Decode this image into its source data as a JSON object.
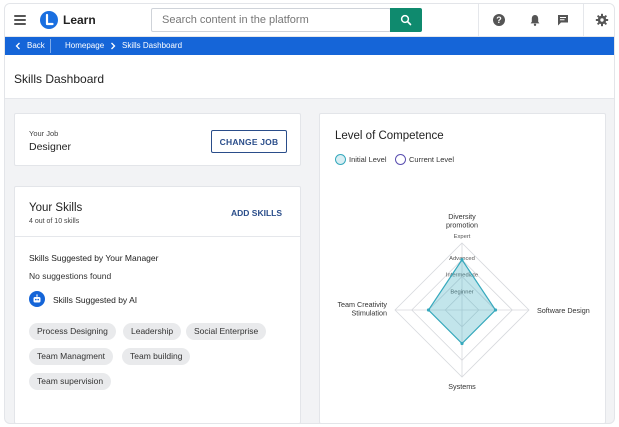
{
  "header": {
    "brand": "Learn",
    "search_placeholder": "Search content in the platform"
  },
  "breadcrumb": {
    "back": "Back",
    "items": [
      "Homepage",
      "Skills Dashboard"
    ]
  },
  "page": {
    "title": "Skills Dashboard"
  },
  "job": {
    "label": "Your Job",
    "value": "Designer",
    "button": "CHANGE JOB"
  },
  "skills": {
    "title": "Your Skills",
    "count": "4 out of 10 skills",
    "add_button": "ADD SKILLS",
    "manager_title": "Skills Suggested by Your Manager",
    "manager_empty": "No suggestions found",
    "ai_title": "Skills Suggested by AI",
    "chips": [
      "Process Designing",
      "Leadership",
      "Social Enterprise",
      "Team Managment",
      "Team building",
      "Team supervision"
    ]
  },
  "colors": {
    "brand": "#1a6fe0",
    "breadcrumb_bar": "#1565d8",
    "search_button": "#0f8a6e",
    "outline_button": "#2a4d8a",
    "initial_level": "#36a9bd",
    "current_level": "#5a4fb0"
  },
  "icons": {
    "menu": "hamburger-icon",
    "logo": "learn-logo-icon",
    "search": "search-icon",
    "help": "help-icon",
    "notifications": "bell-icon",
    "messages": "chat-icon",
    "settings": "gear-icon",
    "back": "chevron-left-icon",
    "separator": "chevron-right-icon",
    "ai": "robot-icon"
  },
  "chart_data": {
    "type": "radar",
    "title": "Level of Competence",
    "axes": [
      "Diversity promotion",
      "Software Design",
      "Systems",
      "Team Creativity Stimulation"
    ],
    "axis_labels_lines": [
      [
        "Diversity",
        "promotion"
      ],
      [
        "Software Design"
      ],
      [
        "Systems"
      ],
      [
        "Team Creativity",
        "Stimulation"
      ]
    ],
    "levels": [
      "Beginner",
      "Intermediate",
      "Advanced",
      "Expert"
    ],
    "max": 4,
    "legend_placement": "top-left",
    "series": [
      {
        "name": "Initial Level",
        "values": [
          3,
          2,
          2,
          2
        ]
      },
      {
        "name": "Current Level",
        "values": [
          3,
          2,
          2,
          2
        ]
      }
    ]
  }
}
